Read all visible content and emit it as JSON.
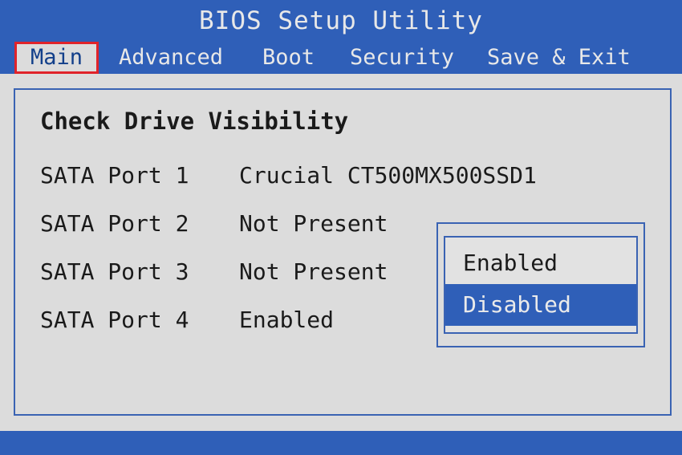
{
  "header": {
    "title": "BIOS Setup Utility"
  },
  "menu": {
    "items": [
      {
        "label": "Main",
        "active": true
      },
      {
        "label": "Advanced",
        "active": false
      },
      {
        "label": "Boot",
        "active": false
      },
      {
        "label": "Security",
        "active": false
      },
      {
        "label": "Save & Exit",
        "active": false
      }
    ]
  },
  "main": {
    "section_title": "Check Drive Visibility",
    "ports": [
      {
        "label": "SATA Port 1",
        "value": "Crucial CT500MX500SSD1"
      },
      {
        "label": "SATA Port 2",
        "value": "Not Present"
      },
      {
        "label": "SATA Port 3",
        "value": "Not Present"
      },
      {
        "label": "SATA Port 4",
        "value": "Enabled"
      }
    ]
  },
  "popup": {
    "options": [
      {
        "label": "Enabled",
        "selected": false
      },
      {
        "label": "Disabled",
        "selected": true
      }
    ]
  },
  "colors": {
    "background_blue": "#2f5fb8",
    "panel_gray": "#dcdcdc",
    "highlight_border": "#e0232a",
    "text_dark": "#1a1a1a"
  }
}
